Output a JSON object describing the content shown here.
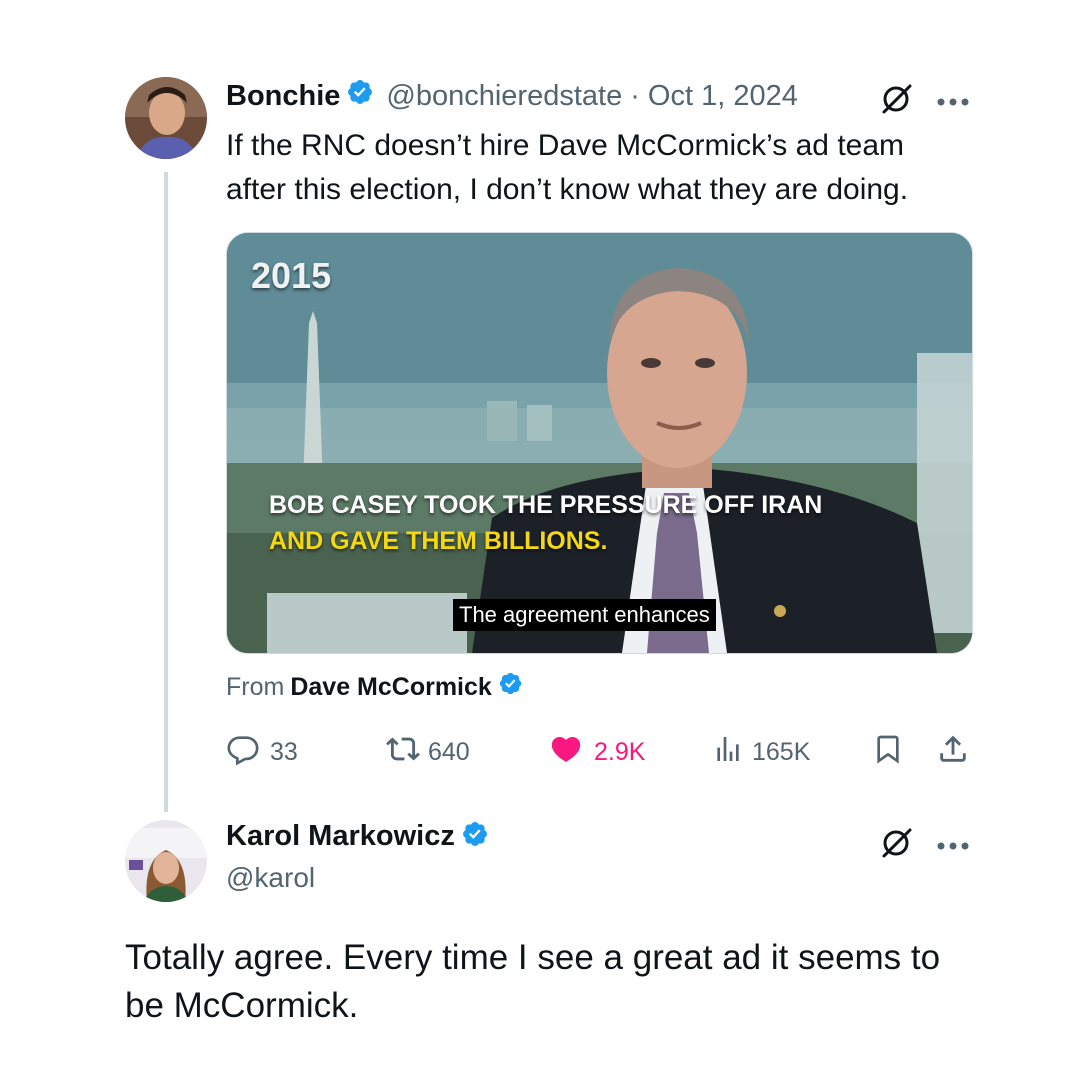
{
  "tweet": {
    "author_name": "Bonchie",
    "handle": "@bonchieredstate",
    "date": "· Oct 1, 2024",
    "text_lines": [
      "If the RNC doesn’t hire Dave McCormick’s ad team",
      "after this election, I don’t know what they are doing."
    ],
    "media": {
      "year_label": "2015",
      "headline_line1": "BOB CASEY TOOK THE PRESSURE OFF IRAN",
      "headline_line2": "AND GAVE THEM BILLIONS.",
      "caption": "The agreement enhances"
    },
    "from_label": "From",
    "from_name": "Dave McCormick",
    "actions": {
      "replies": "33",
      "reposts": "640",
      "likes": "2.9K",
      "views": "165K"
    }
  },
  "reply": {
    "author_name": "Karol Markowicz",
    "handle": "@karol",
    "text_lines": [
      "Totally agree. Every time I see a great ad it seems to",
      "be McCormick."
    ]
  },
  "colors": {
    "verified": "#1d9bf0",
    "like": "#f91880",
    "muted": "#536471",
    "thread_line": "#cfd9de",
    "headline_yellow": "#f4d812"
  },
  "icons": [
    "verified-badge-icon",
    "grok-icon",
    "more-icon",
    "reply-icon",
    "repost-icon",
    "like-icon",
    "views-icon",
    "bookmark-icon",
    "share-icon"
  ]
}
